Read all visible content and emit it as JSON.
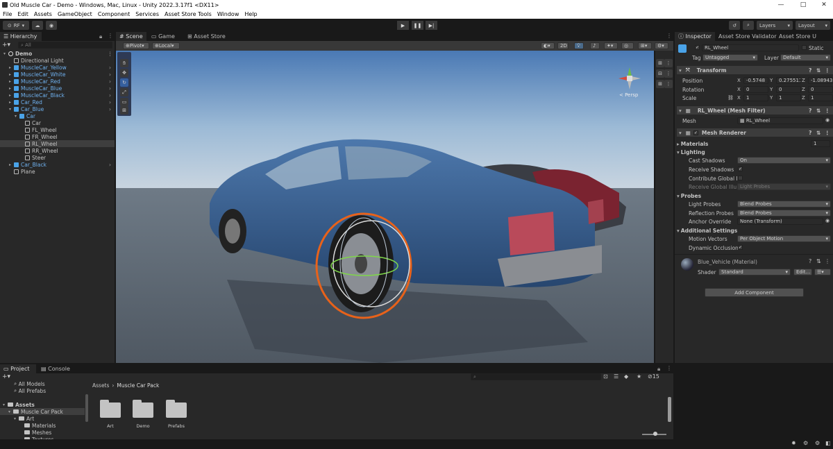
{
  "window": {
    "title": "Old Muscle Car - Demo - Windows, Mac, Linux - Unity 2022.3.17f1 <DX11>"
  },
  "menu": [
    "File",
    "Edit",
    "Assets",
    "GameObject",
    "Component",
    "Services",
    "Asset Store Tools",
    "Window",
    "Help"
  ],
  "toolbar": {
    "account": "RF",
    "layers": "Layers",
    "layout": "Layout"
  },
  "hierarchy": {
    "tab": "Hierarchy",
    "search_placeholder": "All",
    "items": [
      {
        "label": "Demo",
        "depth": 0,
        "type": "scene"
      },
      {
        "label": "Directional Light",
        "depth": 1,
        "type": "object"
      },
      {
        "label": "MuscleCar_Yellow",
        "depth": 1,
        "type": "prefab"
      },
      {
        "label": "MuscleCar_White",
        "depth": 1,
        "type": "prefab"
      },
      {
        "label": "MuscleCar_Red",
        "depth": 1,
        "type": "prefab"
      },
      {
        "label": "MuscleCar_Blue",
        "depth": 1,
        "type": "prefab"
      },
      {
        "label": "MuscleCar_Black",
        "depth": 1,
        "type": "prefab"
      },
      {
        "label": "Car_Red",
        "depth": 1,
        "type": "prefab"
      },
      {
        "label": "Car_Blue",
        "depth": 1,
        "type": "prefab"
      },
      {
        "label": "Car",
        "depth": 2,
        "type": "prefab"
      },
      {
        "label": "Car",
        "depth": 3,
        "type": "object"
      },
      {
        "label": "FL_Wheel",
        "depth": 3,
        "type": "object"
      },
      {
        "label": "FR_Wheel",
        "depth": 3,
        "type": "object"
      },
      {
        "label": "RL_Wheel",
        "depth": 3,
        "type": "object",
        "selected": true
      },
      {
        "label": "RR_Wheel",
        "depth": 3,
        "type": "object"
      },
      {
        "label": "Steer",
        "depth": 3,
        "type": "object"
      },
      {
        "label": "Car_Black",
        "depth": 1,
        "type": "prefab"
      },
      {
        "label": "Plane",
        "depth": 1,
        "type": "object"
      }
    ]
  },
  "scene": {
    "tabs": [
      "Scene",
      "Game",
      "Asset Store"
    ],
    "pivot": "Pivot",
    "local": "Local",
    "mode_2d": "2D",
    "persp": "< Persp"
  },
  "inspector": {
    "tabs": [
      "Inspector",
      "Asset Store Validator",
      "Asset Store U"
    ],
    "object_name": "RL_Wheel",
    "static": "Static",
    "tag_label": "Tag",
    "tag_value": "Untagged",
    "layer_label": "Layer",
    "layer_value": "Default",
    "transform": {
      "title": "Transform",
      "position_label": "Position",
      "rotation_label": "Rotation",
      "scale_label": "Scale",
      "position": [
        "-0.5748",
        "0.275511",
        "-1.08943"
      ],
      "rotation": [
        "0",
        "0",
        "0"
      ],
      "scale": [
        "1",
        "1",
        "1"
      ]
    },
    "mesh_filter": {
      "title": "RL_Wheel (Mesh Filter)",
      "mesh_label": "Mesh",
      "mesh_value": "RL_Wheel"
    },
    "mesh_renderer": {
      "title": "Mesh Renderer",
      "materials_label": "Materials",
      "materials_count": "1",
      "lighting": "Lighting",
      "cast_shadows_label": "Cast Shadows",
      "cast_shadows": "On",
      "receive_shadows_label": "Receive Shadows",
      "contribute_gi_label": "Contribute Global Ill",
      "receive_gi_label": "Receive Global Illun",
      "receive_gi": "Light Probes",
      "probes": "Probes",
      "light_probes_label": "Light Probes",
      "light_probes": "Blend Probes",
      "reflection_probes_label": "Reflection Probes",
      "reflection_probes": "Blend Probes",
      "anchor_override_label": "Anchor Override",
      "anchor_override": "None (Transform)",
      "additional": "Additional Settings",
      "motion_vectors_label": "Motion Vectors",
      "motion_vectors": "Per Object Motion",
      "dynamic_occlusion_label": "Dynamic Occlusion"
    },
    "material": {
      "name": "Blue_Vehicle (Material)",
      "shader_label": "Shader",
      "shader": "Standard",
      "edit": "Edit..."
    },
    "add_component": "Add Component"
  },
  "project": {
    "tabs": [
      "Project",
      "Console"
    ],
    "favorites": [
      "All Models",
      "All Prefabs"
    ],
    "tree": [
      {
        "label": "Assets",
        "depth": 0
      },
      {
        "label": "Muscle Car Pack",
        "depth": 1
      },
      {
        "label": "Art",
        "depth": 2
      },
      {
        "label": "Materials",
        "depth": 3
      },
      {
        "label": "Meshes",
        "depth": 3
      },
      {
        "label": "Textures",
        "depth": 3
      }
    ],
    "breadcrumb": [
      "Assets",
      "Muscle Car Pack"
    ],
    "folders": [
      "Art",
      "Demo",
      "Prefabs"
    ],
    "hidden_count": "15"
  }
}
